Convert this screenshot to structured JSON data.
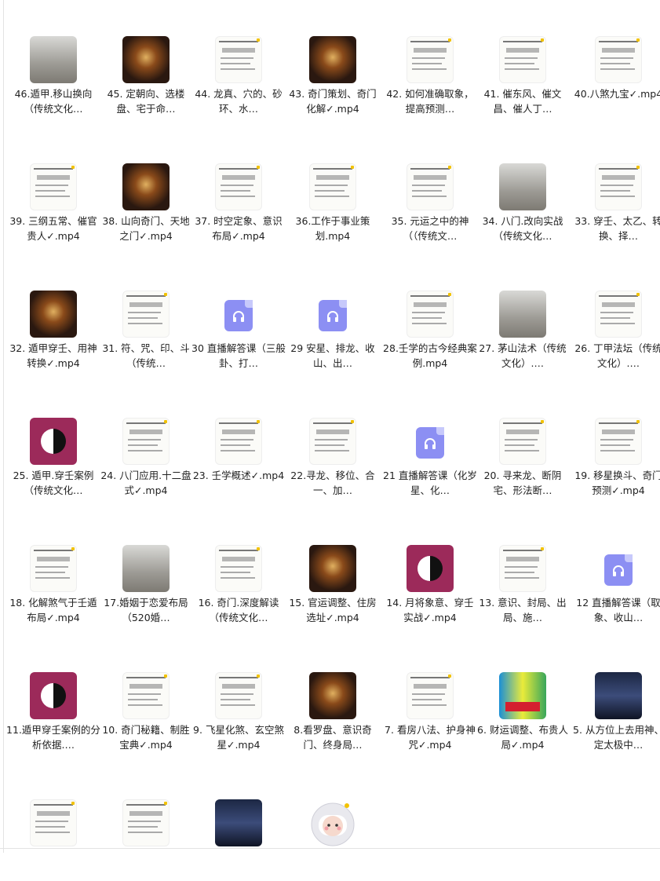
{
  "items": [
    {
      "label": "46.遁甲.移山换向（传统文化…",
      "thumb": "gray",
      "icon": "video-thumbnail-icon"
    },
    {
      "label": "45. 定朝向、选楼盘、宅于命…",
      "thumb": "dark",
      "icon": "video-thumbnail-icon"
    },
    {
      "label": "44. 龙真、穴的、砂环、水…",
      "thumb": "doc",
      "icon": "video-thumbnail-icon"
    },
    {
      "label": "43. 奇门策划、奇门化解✓.mp4",
      "thumb": "dark",
      "icon": "video-thumbnail-icon"
    },
    {
      "label": "42. 如何准确取象，提高预测…",
      "thumb": "doc",
      "icon": "video-thumbnail-icon"
    },
    {
      "label": "41. 催东风、催文昌、催人丁…",
      "thumb": "doc",
      "icon": "video-thumbnail-icon"
    },
    {
      "label": "40.八煞九宝✓.mp4",
      "thumb": "doc",
      "icon": "video-thumbnail-icon"
    },
    {
      "label": "39. 三纲五常、催官贵人✓.mp4",
      "thumb": "doc",
      "icon": "video-thumbnail-icon"
    },
    {
      "label": "38. 山向奇门、天地之门✓.mp4",
      "thumb": "dark",
      "icon": "video-thumbnail-icon"
    },
    {
      "label": "37. 时空定象、意识布局✓.mp4",
      "thumb": "doc",
      "icon": "video-thumbnail-icon"
    },
    {
      "label": "36.工作于事业策划.mp4",
      "thumb": "doc",
      "icon": "video-thumbnail-icon"
    },
    {
      "label": "35. 元运之中的神（（传统文…",
      "thumb": "doc",
      "icon": "video-thumbnail-icon"
    },
    {
      "label": "34. 八门.改向实战（传统文化…",
      "thumb": "gray",
      "icon": "video-thumbnail-icon"
    },
    {
      "label": "33. 穿壬、太乙、转换、择…",
      "thumb": "doc",
      "icon": "video-thumbnail-icon"
    },
    {
      "label": "32. 遁甲穿壬、用神转换✓.mp4",
      "thumb": "dark",
      "icon": "video-thumbnail-icon"
    },
    {
      "label": "31. 符、咒、印、斗（传统…",
      "thumb": "doc",
      "icon": "video-thumbnail-icon"
    },
    {
      "label": "30 直播解答课（三般卦、打…",
      "thumb": "audio",
      "icon": "audio-file-icon"
    },
    {
      "label": "29 安星、排龙、收山、出…",
      "thumb": "audio",
      "icon": "audio-file-icon"
    },
    {
      "label": "28.壬学的古今经典案例.mp4",
      "thumb": "doc",
      "icon": "video-thumbnail-icon"
    },
    {
      "label": "27. 茅山法术（传统文化）.…",
      "thumb": "gray",
      "icon": "video-thumbnail-icon"
    },
    {
      "label": "26. 丁甲法坛（传统文化）.…",
      "thumb": "doc",
      "icon": "video-thumbnail-icon"
    },
    {
      "label": "25. 遁甲.穿壬案例（传统文化…",
      "thumb": "pink",
      "icon": "video-thumbnail-icon"
    },
    {
      "label": "24. 八门应用.十二盘式✓.mp4",
      "thumb": "doc",
      "icon": "video-thumbnail-icon"
    },
    {
      "label": "23. 壬学概述✓.mp4",
      "thumb": "doc",
      "icon": "video-thumbnail-icon"
    },
    {
      "label": "22.寻龙、移位、合一、加…",
      "thumb": "doc",
      "icon": "video-thumbnail-icon"
    },
    {
      "label": "21 直播解答课（化岁星、化…",
      "thumb": "audio",
      "icon": "audio-file-icon"
    },
    {
      "label": "20. 寻来龙、断阴宅、形法断…",
      "thumb": "doc",
      "icon": "video-thumbnail-icon"
    },
    {
      "label": "19. 移星换斗、奇门预测✓.mp4",
      "thumb": "doc",
      "icon": "video-thumbnail-icon"
    },
    {
      "label": "18. 化解煞气于壬遁布局✓.mp4",
      "thumb": "doc",
      "icon": "video-thumbnail-icon"
    },
    {
      "label": "17.婚姻于恋爱布局（520婚…",
      "thumb": "gray",
      "icon": "video-thumbnail-icon"
    },
    {
      "label": "16. 奇门.深度解读（传统文化…",
      "thumb": "doc",
      "icon": "video-thumbnail-icon"
    },
    {
      "label": "15. 官运调整、住房选址✓.mp4",
      "thumb": "dark",
      "icon": "video-thumbnail-icon"
    },
    {
      "label": "14. 月将象意、穿壬实战✓.mp4",
      "thumb": "pink",
      "icon": "video-thumbnail-icon"
    },
    {
      "label": "13. 意识、封局、出局、施…",
      "thumb": "doc",
      "icon": "video-thumbnail-icon"
    },
    {
      "label": "12 直播解答课（取象、收山…",
      "thumb": "audio",
      "icon": "audio-file-icon"
    },
    {
      "label": "11.遁甲穿壬案例的分析依据.…",
      "thumb": "pink",
      "icon": "video-thumbnail-icon"
    },
    {
      "label": "10. 奇门秘籍、制胜宝典✓.mp4",
      "thumb": "doc",
      "icon": "video-thumbnail-icon"
    },
    {
      "label": "9. 飞星化煞、玄空煞星✓.mp4",
      "thumb": "doc",
      "icon": "video-thumbnail-icon"
    },
    {
      "label": "8.看罗盘、意识奇门、终身局…",
      "thumb": "dark",
      "icon": "video-thumbnail-icon"
    },
    {
      "label": "7. 看房八法、护身神咒✓.mp4",
      "thumb": "doc",
      "icon": "video-thumbnail-icon"
    },
    {
      "label": "6. 财运调整、布贵人局✓.mp4",
      "thumb": "color",
      "icon": "video-thumbnail-icon"
    },
    {
      "label": "5. 从方位上去用神、定太极中…",
      "thumb": "night",
      "icon": "video-thumbnail-icon"
    },
    {
      "label": "",
      "thumb": "doc",
      "icon": "video-thumbnail-icon"
    },
    {
      "label": "",
      "thumb": "doc",
      "icon": "video-thumbnail-icon"
    },
    {
      "label": "",
      "thumb": "night",
      "icon": "video-thumbnail-icon"
    },
    {
      "label": "",
      "thumb": "avatar",
      "icon": "astronaut-avatar-icon"
    }
  ]
}
